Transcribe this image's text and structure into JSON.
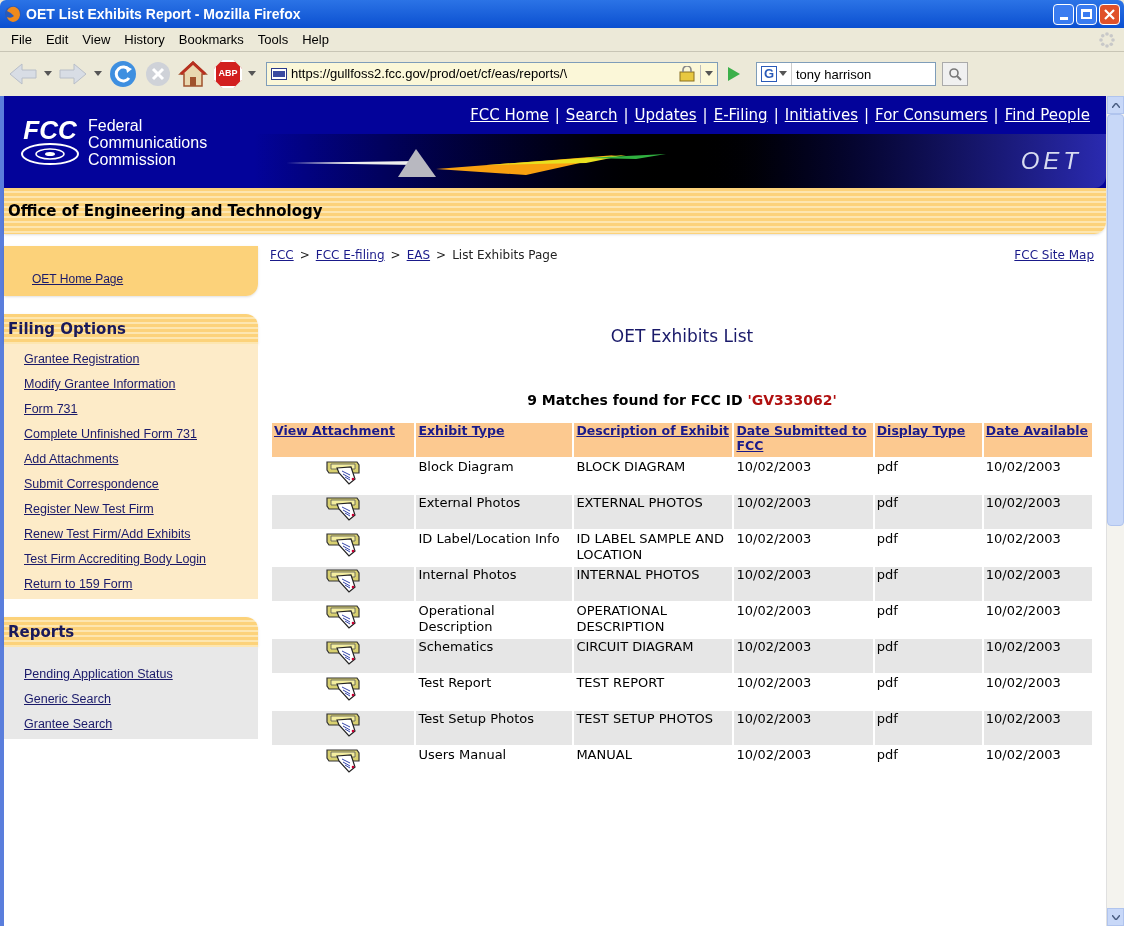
{
  "window": {
    "title": "OET List Exhibits Report - Mozilla Firefox"
  },
  "menu": [
    "File",
    "Edit",
    "View",
    "History",
    "Bookmarks",
    "Tools",
    "Help"
  ],
  "toolbar": {
    "url": "https://gullfoss2.fcc.gov/prod/oet/cf/eas/reports/\\",
    "search_value": "tony harrison",
    "adblock_label": "ABP",
    "search_engine": "G"
  },
  "header": {
    "logo": "FCC",
    "agency": [
      "Federal",
      "Communications",
      "Commission"
    ],
    "separator": "|",
    "links": [
      "FCC Home",
      "Search",
      "Updates",
      "E-Filing",
      "Initiatives",
      "For Consumers",
      "Find People"
    ],
    "banner_mark": "OET"
  },
  "office_title": "Office of Engineering and Technology",
  "sidebar": {
    "home_link": "OET Home Page",
    "sections": [
      {
        "title": "Filing Options",
        "kind": "filing",
        "items": [
          "Grantee Registration",
          "Modify Grantee Information",
          "Form 731",
          "Complete Unfinished Form 731",
          "Add Attachments",
          "Submit Correspondence",
          "Register New Test Firm",
          "Renew Test Firm/Add Exhibits",
          "Test Firm Accrediting Body Login",
          "Return to 159 Form"
        ]
      },
      {
        "title": "Reports",
        "kind": "reports",
        "items": [
          "Pending Application Status",
          "Generic Search",
          "Grantee Search"
        ]
      }
    ]
  },
  "breadcrumb": {
    "separator": ">",
    "links": [
      "FCC",
      "FCC E-filing",
      "EAS"
    ],
    "current": "List Exhibits Page",
    "site_map": "FCC Site Map"
  },
  "page_title": "OET Exhibits List",
  "matches": {
    "text": "9 Matches found for FCC ID ",
    "id": "'GV333062'"
  },
  "table": {
    "columns": [
      "View Attachment",
      "Exhibit Type",
      "Description of Exhibit",
      "Date Submitted to FCC",
      "Display Type",
      "Date Available"
    ],
    "rows": [
      {
        "exhibit_type": "Block Diagram",
        "description": "BLOCK DIAGRAM",
        "date_submitted": "10/02/2003",
        "display_type": "pdf",
        "date_available": "10/02/2003"
      },
      {
        "exhibit_type": "External Photos",
        "description": "EXTERNAL PHOTOS",
        "date_submitted": "10/02/2003",
        "display_type": "pdf",
        "date_available": "10/02/2003"
      },
      {
        "exhibit_type": "ID Label/Location Info",
        "description": "ID LABEL SAMPLE AND LOCATION",
        "date_submitted": "10/02/2003",
        "display_type": "pdf",
        "date_available": "10/02/2003"
      },
      {
        "exhibit_type": "Internal Photos",
        "description": "INTERNAL PHOTOS",
        "date_submitted": "10/02/2003",
        "display_type": "pdf",
        "date_available": "10/02/2003"
      },
      {
        "exhibit_type": "Operational Description",
        "description": "OPERATIONAL DESCRIPTION",
        "date_submitted": "10/02/2003",
        "display_type": "pdf",
        "date_available": "10/02/2003"
      },
      {
        "exhibit_type": "Schematics",
        "description": "CIRCUIT DIAGRAM",
        "date_submitted": "10/02/2003",
        "display_type": "pdf",
        "date_available": "10/02/2003"
      },
      {
        "exhibit_type": "Test Report",
        "description": "TEST REPORT",
        "date_submitted": "10/02/2003",
        "display_type": "pdf",
        "date_available": "10/02/2003"
      },
      {
        "exhibit_type": "Test Setup Photos",
        "description": "TEST SETUP PHOTOS",
        "date_submitted": "10/02/2003",
        "display_type": "pdf",
        "date_available": "10/02/2003"
      },
      {
        "exhibit_type": "Users Manual",
        "description": "MANUAL",
        "date_submitted": "10/02/2003",
        "display_type": "pdf",
        "date_available": "10/02/2003"
      }
    ]
  }
}
